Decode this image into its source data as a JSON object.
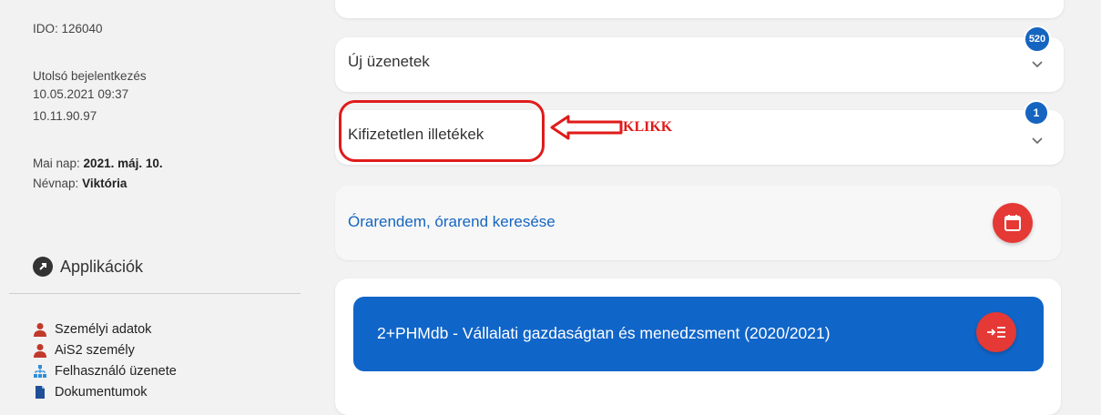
{
  "sidebar": {
    "ido": "IDO: 126040",
    "last_login_label": "Utolsó bejelentkezés",
    "last_login_time": "10.05.2021 09:37",
    "last_login_ip": "10.11.90.97",
    "today_label": "Mai nap:",
    "today_value": "2021. máj. 10.",
    "nameday_label": "Névnap:",
    "nameday_value": "Viktória",
    "apps_title": "Applikációk",
    "apps": [
      {
        "label": "Személyi adatok",
        "icon": "person-icon"
      },
      {
        "label": "AiS2 személy",
        "icon": "person-icon"
      },
      {
        "label": "Felhasználó üzenete",
        "icon": "org-chart-icon"
      },
      {
        "label": "Dokumentumok",
        "icon": "document-icon"
      }
    ]
  },
  "main": {
    "new_messages": {
      "label": "Új üzenetek",
      "badge": "520"
    },
    "unpaid_fees": {
      "label": "Kifizetetlen illetékek",
      "badge": "1"
    },
    "timetable": {
      "label": "Órarendem, órarend keresése"
    },
    "course": {
      "title": "2+PHMdb - Vállalati gazdaságtan és menedzsment (2020/2021)"
    }
  },
  "annotation": {
    "text": "KLIKK",
    "color": "#e01b1b"
  },
  "colors": {
    "accent": "#1565c0",
    "red": "#e53935",
    "course_bg": "#1065c8"
  }
}
